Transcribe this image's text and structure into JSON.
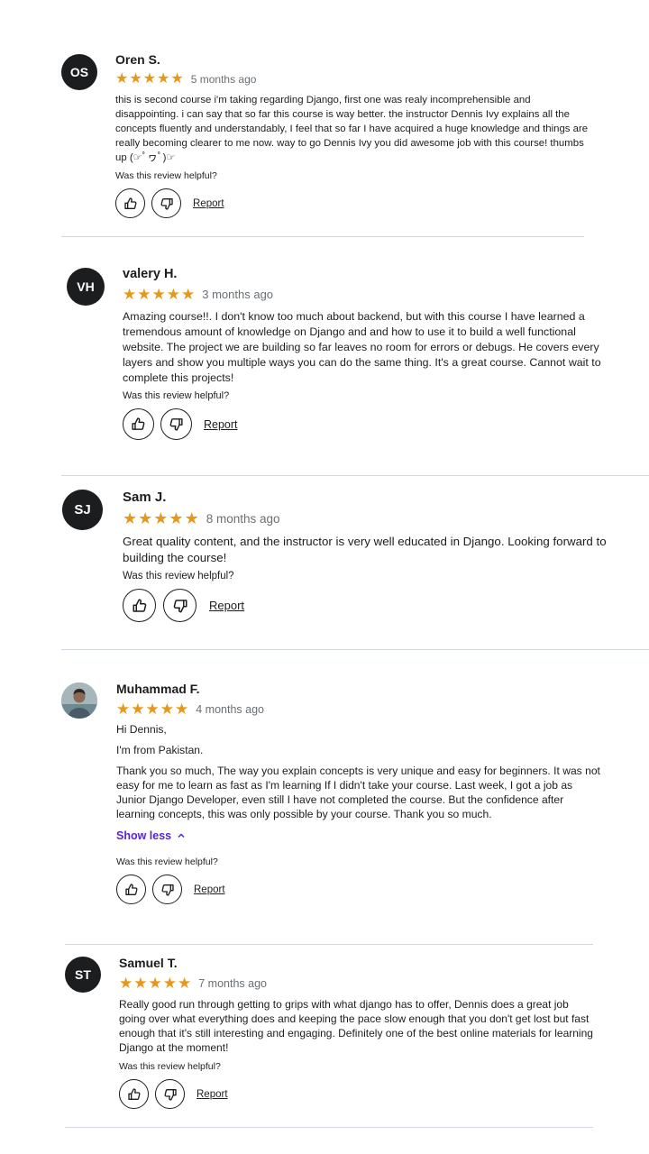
{
  "star_color": "#e59819",
  "link_color": "#5624d0",
  "reviews": [
    {
      "initials": "OS",
      "name": "Oren S.",
      "rating": 5,
      "time_ago": "5 months ago",
      "paragraphs": [
        "this is second course i'm taking regarding Django, first one was realy incomprehensible and disappointing. i can say that so far this course is way better. the instructor Dennis Ivy explains all the concepts fluently and understandably, I feel that so far I have acquired a huge knowledge and things are really becoming clearer to me now. way to go Dennis Ivy you did awesome job with this course! thumbs up (☞ﾟヮﾟ)☞"
      ],
      "helpful_prompt": "Was this review helpful?",
      "report_label": "Report"
    },
    {
      "initials": "VH",
      "name": "valery H.",
      "rating": 5,
      "time_ago": "3 months ago",
      "paragraphs": [
        "Amazing course!!. I don't know too much about backend, but with this course I have learned a tremendous amount of knowledge on Django and and how to use it to build a well functional website. The project we are building so far leaves no room for errors or debugs. He covers every layers and show you multiple ways you can do the same thing. It's a great course. Cannot wait to complete this projects!"
      ],
      "helpful_prompt": "Was this review helpful?",
      "report_label": "Report"
    },
    {
      "initials": "SJ",
      "name": "Sam J.",
      "rating": 5,
      "time_ago": "8 months ago",
      "paragraphs": [
        "Great quality content, and the instructor is very well educated in Django. Looking forward to building the course!"
      ],
      "helpful_prompt": "Was this review helpful?",
      "report_label": "Report"
    },
    {
      "initials": "",
      "name": "Muhammad F.",
      "rating": 5,
      "time_ago": "4 months ago",
      "paragraphs": [
        "Hi Dennis,",
        "I'm from Pakistan.",
        "Thank you so much, The way you explain concepts is very unique and easy for beginners. It was not easy for me to learn as fast as I'm learning If I didn't take your course. Last week, I got a job as Junior Django Developer, even still I have not completed the course. But the confidence after learning concepts, this was only possible by your course. Thank you so much."
      ],
      "show_less_label": "Show less",
      "helpful_prompt": "Was this review helpful?",
      "report_label": "Report"
    },
    {
      "initials": "ST",
      "name": "Samuel T.",
      "rating": 5,
      "time_ago": "7 months ago",
      "paragraphs": [
        "Really good run through getting to grips with what django has to offer, Dennis does a great job going over what everything does and keeping the pace slow enough that you don't get lost but fast enough that it's still interesting and engaging. Definitely one of the best online materials for learning Django at the moment!"
      ],
      "helpful_prompt": "Was this review helpful?",
      "report_label": "Report"
    }
  ]
}
